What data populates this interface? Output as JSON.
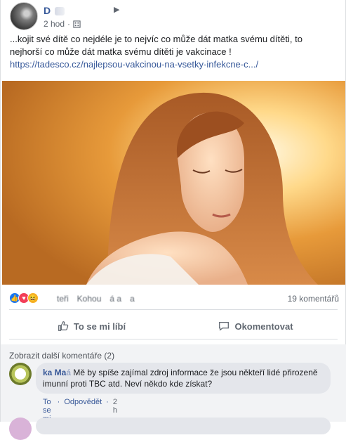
{
  "post": {
    "author_name": "D",
    "timestamp": "2 hod",
    "text_line1": "...kojit své dítě co nejdéle je to nejvíc co může dát matka svému dítěti, to",
    "text_line2": "nejhorší co může dát matka svému dítěti je vakcinace !",
    "link": "https://tadesco.cz/najlepsou-vakcinou-na-vsetky-infekcne-c.../",
    "photo_alt": "",
    "reaction_names": [
      "teři",
      "Kohou",
      "á a",
      "a"
    ],
    "comments_count": "19 komentářů",
    "like_label": "To se mi líbí",
    "comment_label": "Okomentovat"
  },
  "comments": {
    "more_label": "Zobrazit další komentáře (2)",
    "items": [
      {
        "author": "ka Ma",
        "author_blur": "á",
        "text": "Mě by spíše zajímal zdroj informace že jsou někteří lidé přirozeně imunní proti TBC atd. Neví někdo kde získat?",
        "like": "To se mi líbí",
        "reply": "Odpovědět",
        "time": "2 h"
      }
    ]
  },
  "colors": {
    "link": "#365899",
    "like_blue": "#1877f2",
    "love_red": "#f33e58",
    "haha_yellow": "#f7b125"
  }
}
